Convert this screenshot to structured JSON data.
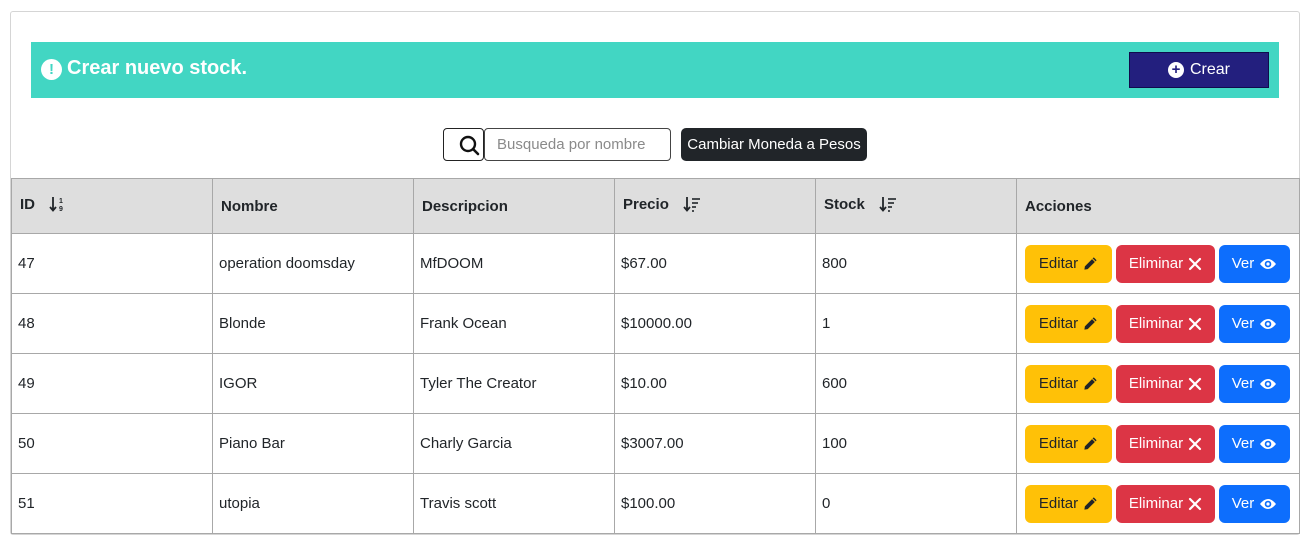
{
  "banner": {
    "icon": "exclamation-circle-icon",
    "title": "Crear nuevo stock.",
    "create_button_label": "Crear",
    "color": "#42d6c3",
    "button_color": "#231f7e"
  },
  "search": {
    "icon": "search-icon",
    "placeholder": "Busqueda por nombre",
    "value": ""
  },
  "currency_button_label": "Cambiar Moneda a Pesos",
  "table": {
    "columns": [
      {
        "label": "ID",
        "sort_icon": "sort-numeric-down-icon"
      },
      {
        "label": "Nombre"
      },
      {
        "label": "Descripcion"
      },
      {
        "label": "Precio",
        "sort_icon": "sort-amount-down-icon"
      },
      {
        "label": "Stock",
        "sort_icon": "sort-amount-down-icon"
      },
      {
        "label": "Acciones"
      }
    ],
    "rows": [
      {
        "id": "47",
        "nombre": "operation doomsday",
        "descripcion": "MfDOOM",
        "precio": "$67.00",
        "stock": "800"
      },
      {
        "id": "48",
        "nombre": "Blonde",
        "descripcion": "Frank Ocean",
        "precio": "$10000.00",
        "stock": "1"
      },
      {
        "id": "49",
        "nombre": "IGOR",
        "descripcion": "Tyler The Creator",
        "precio": "$10.00",
        "stock": "600"
      },
      {
        "id": "50",
        "nombre": "Piano Bar",
        "descripcion": "Charly Garcia",
        "precio": "$3007.00",
        "stock": "100"
      },
      {
        "id": "51",
        "nombre": "utopia",
        "descripcion": "Travis scott",
        "precio": "$100.00",
        "stock": "0"
      }
    ],
    "actions": {
      "edit_label": "Editar",
      "delete_label": "Eliminar",
      "view_label": "Ver",
      "edit_icon": "pencil-icon",
      "delete_icon": "x-icon",
      "view_icon": "eye-icon",
      "edit_color": "#ffc107",
      "delete_color": "#dc3545",
      "view_color": "#0d6efd"
    }
  }
}
